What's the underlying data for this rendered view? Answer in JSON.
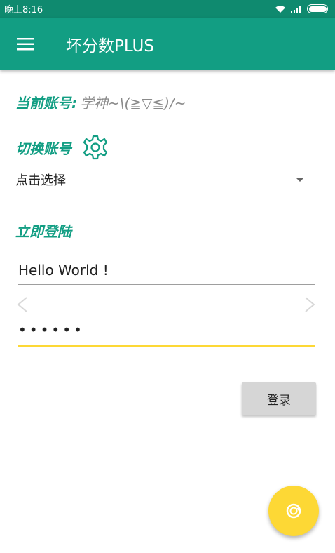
{
  "status_bar": {
    "time": "晚上8:16"
  },
  "app_bar": {
    "title": "坏分数PLUS"
  },
  "account": {
    "label": "当前账号:",
    "value": "学神~\\(≧▽≦)/~"
  },
  "switch_account": {
    "label": "切换账号",
    "select_value": "点击选择"
  },
  "login": {
    "heading": "立即登陆",
    "username_value": "Hello World !",
    "password_value": "••••••",
    "button_label": "登录"
  },
  "colors": {
    "primary": "#129e83",
    "primary_dark": "#0f8a6f",
    "accent": "#fdd835"
  },
  "icons": {
    "menu": "hamburger-icon",
    "settings": "gear-icon",
    "fab": "refresh-icon"
  }
}
